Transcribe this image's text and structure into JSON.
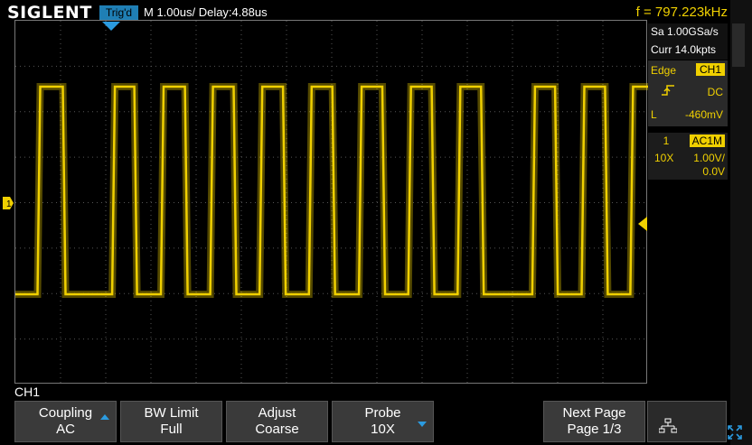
{
  "header": {
    "brand": "SIGLENT",
    "trig_status": "Trig'd",
    "timebase": "M 1.00us/  Delay:4.88us",
    "frequency": "f = 797.223kHz"
  },
  "acquisition": {
    "sample_rate": "Sa 1.00GSa/s",
    "memory_depth": "Curr 14.0kpts"
  },
  "trigger": {
    "type": "Edge",
    "source": "CH1",
    "coupling": "DC",
    "level_label": "L",
    "level": "-460mV"
  },
  "channel": {
    "number": "1",
    "coupling": "AC1M",
    "probe": "10X",
    "scale": "1.00V/",
    "offset": "0.0V",
    "marker": "1"
  },
  "menu": {
    "title": "CH1",
    "buttons": [
      {
        "label": "Coupling",
        "value": "AC"
      },
      {
        "label": "BW Limit",
        "value": "Full"
      },
      {
        "label": "Adjust",
        "value": "Coarse"
      },
      {
        "label": "Probe",
        "value": "10X"
      },
      {
        "label": "",
        "value": ""
      },
      {
        "label": "Next Page",
        "value": "Page 1/3"
      }
    ]
  },
  "colors": {
    "trace": "#f0d000",
    "trig_box": "#1f7fb5",
    "grid": "#555555"
  },
  "waveform": {
    "segments": [
      {
        "state": "high",
        "start": 0.035,
        "end": 0.075
      },
      {
        "state": "high",
        "start": 0.153,
        "end": 0.188
      },
      {
        "state": "high",
        "start": 0.23,
        "end": 0.268
      },
      {
        "state": "high",
        "start": 0.308,
        "end": 0.345
      },
      {
        "state": "high",
        "start": 0.386,
        "end": 0.423
      },
      {
        "state": "high",
        "start": 0.464,
        "end": 0.501
      },
      {
        "state": "high",
        "start": 0.543,
        "end": 0.58
      },
      {
        "state": "high",
        "start": 0.621,
        "end": 0.658
      },
      {
        "state": "high",
        "start": 0.699,
        "end": 0.736
      },
      {
        "state": "high",
        "start": 0.817,
        "end": 0.853
      },
      {
        "state": "high",
        "start": 0.895,
        "end": 0.932
      },
      {
        "state": "high",
        "start": 0.972,
        "end": 1.0
      }
    ]
  }
}
